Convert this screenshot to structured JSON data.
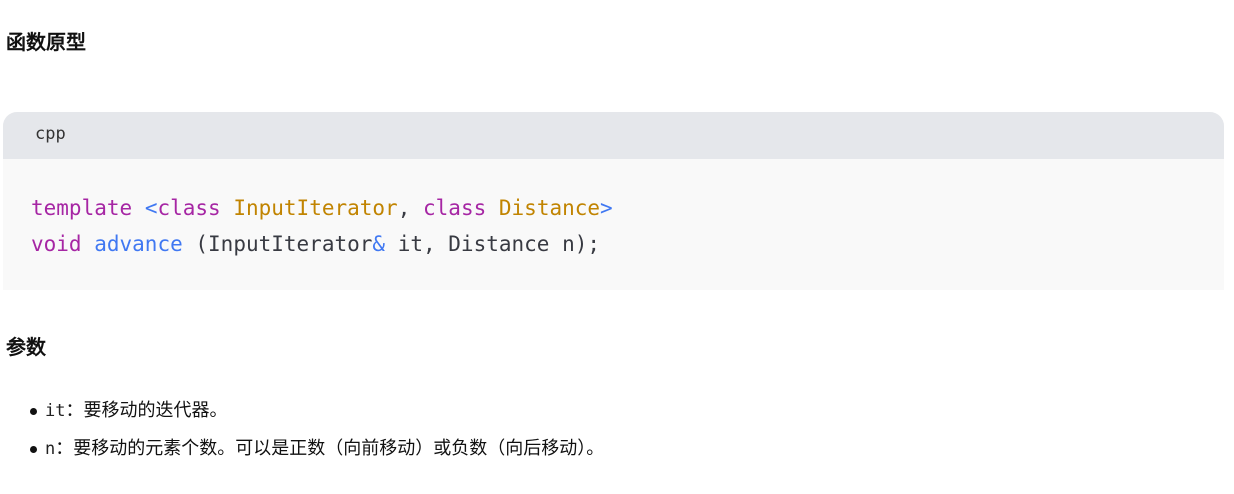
{
  "sections": {
    "prototype_heading": "函数原型",
    "params_heading": "参数"
  },
  "code_block": {
    "language": "cpp",
    "line1": {
      "t1": "template",
      "t2": " ",
      "t3": "<",
      "t4": "class",
      "t5": " ",
      "t6": "InputIterator",
      "t7": ", ",
      "t8": "class",
      "t9": " ",
      "t10": "Distance",
      "t11": ">"
    },
    "line2": {
      "t1": "void",
      "t2": " ",
      "t3": "advance",
      "t4": " (InputIterator",
      "t5": "&",
      "t6": " it, Distance n);"
    }
  },
  "params": [
    {
      "name": "it",
      "sep": "：",
      "desc": "要移动的迭代器。"
    },
    {
      "name": "n",
      "sep": "：",
      "desc": "要移动的元素个数。可以是正数（向前移动）或负数（向后移动）。"
    }
  ],
  "colors": {
    "keyword": "#a626a4",
    "function": "#4078f2",
    "type": "#c18401",
    "code_background": "#f9f9f9",
    "code_header_background": "#e5e7eb"
  }
}
